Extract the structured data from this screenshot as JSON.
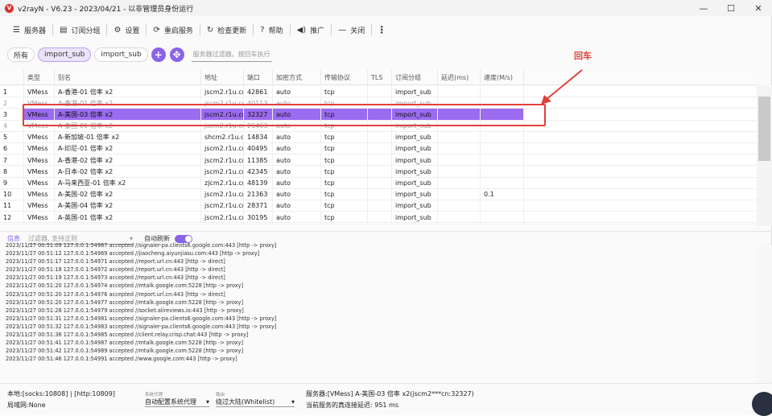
{
  "window": {
    "title": "v2rayN - V6.23 - 2023/04/21 - 以非管理员身份运行",
    "controls": [
      "—",
      "☐",
      "✕"
    ]
  },
  "toolbar": {
    "items": [
      {
        "icon": "list-icon",
        "label": "服务器"
      },
      {
        "icon": "subscription-icon",
        "label": "订阅分组"
      },
      {
        "icon": "gear-icon",
        "label": "设置"
      },
      {
        "icon": "restart-icon",
        "label": "重启服务"
      },
      {
        "icon": "refresh-icon",
        "label": "检查更新"
      },
      {
        "icon": "help-icon",
        "label": "帮助"
      },
      {
        "icon": "speaker-icon",
        "label": "推广"
      },
      {
        "icon": "minus-icon",
        "label": "关闭"
      }
    ]
  },
  "filters": {
    "chips": [
      "所有",
      "import_sub",
      "import_sub"
    ],
    "selected_index": 1,
    "placeholder": "服务器过滤器，按回车执行"
  },
  "annotation": {
    "label": "回车",
    "color": "#e0403a"
  },
  "table": {
    "columns": [
      "",
      "类型",
      "别名",
      "地址",
      "端口",
      "加密方式",
      "传输协议",
      "TLS",
      "订阅分组",
      "延迟(ms)",
      "速度(M/s)"
    ],
    "rows": [
      [
        "1",
        "VMess",
        "A-香港-01 倍率 x2",
        "jscm2.r1u.cn",
        "42861",
        "auto",
        "tcp",
        "",
        "import_sub",
        "",
        ""
      ],
      [
        "2",
        "VMess",
        "A-香港-01 倍率 x2",
        "jscm2.r1u.cn",
        "40113",
        "auto",
        "tcp",
        "",
        "import_sub",
        "",
        ""
      ],
      [
        "3",
        "VMess",
        "A-美国-03 倍率 x2",
        "jscm2.r1u.cn",
        "32327",
        "auto",
        "tcp",
        "",
        "import_sub",
        "",
        ""
      ],
      [
        "4",
        "VMess",
        "A-泰国-01 倍率 x2",
        "jscm2.r1u.cn",
        "26463",
        "auto",
        "tcp",
        "",
        "import_sub",
        "",
        ""
      ],
      [
        "5",
        "VMess",
        "A-新加坡-01 倍率 x2",
        "shcm2.r1u.cn",
        "14834",
        "auto",
        "tcp",
        "",
        "import_sub",
        "",
        ""
      ],
      [
        "6",
        "VMess",
        "A-印尼-01 倍率 x2",
        "jscm2.r1u.cn",
        "40495",
        "auto",
        "tcp",
        "",
        "import_sub",
        "",
        ""
      ],
      [
        "7",
        "VMess",
        "A-香港-02 倍率 x2",
        "jscm2.r1u.cn",
        "11385",
        "auto",
        "tcp",
        "",
        "import_sub",
        "",
        ""
      ],
      [
        "8",
        "VMess",
        "A-日本-02 倍率 x2",
        "jscm2.r1u.cn",
        "42345",
        "auto",
        "tcp",
        "",
        "import_sub",
        "",
        ""
      ],
      [
        "9",
        "VMess",
        "A-马来西亚-01 倍率 x2",
        "zjcm2.r1u.cn",
        "48139",
        "auto",
        "tcp",
        "",
        "import_sub",
        "",
        ""
      ],
      [
        "10",
        "VMess",
        "A-美国-02 倍率 x2",
        "jscm2.r1u.cn",
        "21363",
        "auto",
        "tcp",
        "",
        "import_sub",
        "",
        "0.1"
      ],
      [
        "11",
        "VMess",
        "A-美国-04 倍率 x2",
        "jscm2.r1u.cn",
        "28371",
        "auto",
        "tcp",
        "",
        "import_sub",
        "",
        ""
      ],
      [
        "12",
        "VMess",
        "A-英国-01 倍率 x2",
        "jscm2.r1u.cn",
        "30195",
        "auto",
        "tcp",
        "",
        "import_sub",
        "",
        ""
      ]
    ],
    "selected_row": 2,
    "highlight_color": "#9b6bf0"
  },
  "logpanel": {
    "tab": "信息",
    "filter_placeholder": "过滤器, 支持正则",
    "auto_refresh_label": "自动刷新",
    "auto_refresh_on": true,
    "lines": [
      "2023/11/27 00:51:09 127.0.0.1:54967 accepted //signaler-pa.clients6.google.com:443 [http -> proxy]",
      "2023/11/27 00:51:12 127.0.0.1:54969 accepted //jiaocheng.aiyunjiasu.com:443 [http -> proxy]",
      "2023/11/27 00:51:17 127.0.0.1:54971 accepted //report.url.cn:443 [http -> direct]",
      "2023/11/27 00:51:18 127.0.0.1:54972 accepted //report.url.cn:443 [http -> direct]",
      "2023/11/27 00:51:19 127.0.0.1:54973 accepted //report.url.cn:443 [http -> direct]",
      "2023/11/27 00:51:20 127.0.0.1:54974 accepted //mtalk.google.com:5228 [http -> proxy]",
      "2023/11/27 00:51:20 127.0.0.1:54976 accepted //report.url.cn:443 [http -> direct]",
      "2023/11/27 00:51:20 127.0.0.1:54977 accepted //mtalk.google.com:5228 [http -> proxy]",
      "2023/11/27 00:51:28 127.0.0.1:54979 accepted //socket.alireviews.io:443 [http -> proxy]",
      "2023/11/27 00:51:31 127.0.0.1:54981 accepted //signaler-pa.clients6.google.com:443 [http -> proxy]",
      "2023/11/27 00:51:32 127.0.0.1:54983 accepted //signaler-pa.clients6.google.com:443 [http -> proxy]",
      "2023/11/27 00:51:36 127.0.0.1:54985 accepted //client.relay.crisp.chat:443 [http -> proxy]",
      "2023/11/27 00:51:41 127.0.0.1:54987 accepted //mtalk.google.com:5228 [http -> proxy]",
      "2023/11/27 00:51:42 127.0.0.1:54989 accepted //mtalk.google.com:5228 [http -> proxy]",
      "2023/11/27 00:51:46 127.0.0.1:54991 accepted //www.google.com:443 [http -> proxy]"
    ]
  },
  "status": {
    "local_ports": "本地:[socks:10808] | [http:10809]",
    "lan": "局域网:None",
    "proxy_caption": "系统代理",
    "proxy_mode": "自动配置系统代理",
    "routing_caption": "路由",
    "routing_mode": "绕过大陆(Whitelist)",
    "server_info": "服务器:[VMess] A-美国-03 倍率 x2(jscm2***cn:32327)",
    "latency": "当前服务的真连接延迟: 951 ms"
  }
}
